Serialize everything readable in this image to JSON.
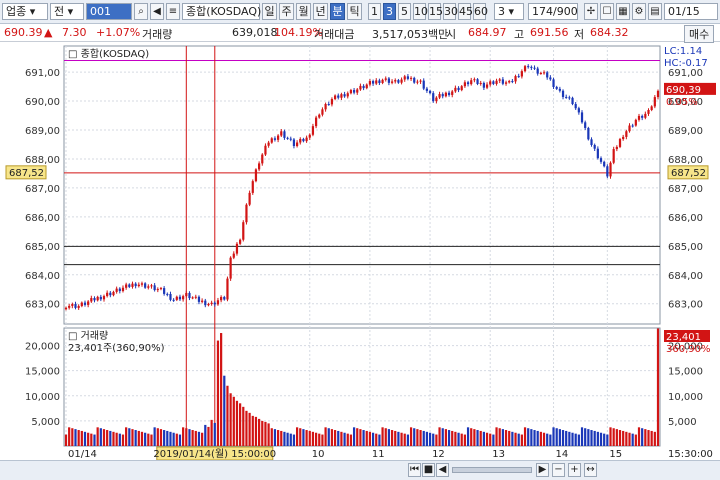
{
  "toolbar": {
    "market": "업종",
    "scope": "전",
    "code": "001",
    "name": "종합(KOSDAQ)",
    "period_tabs": [
      "일",
      "주",
      "월",
      "년",
      "분",
      "틱"
    ],
    "active_period": "분",
    "minute_tabs": [
      "1",
      "3",
      "5",
      "10",
      "15",
      "30",
      "45",
      "60"
    ],
    "active_minute": "3",
    "count_select": "3",
    "page_counter": "174/900",
    "date": "01/15"
  },
  "info": {
    "price": "690.39",
    "price_arrow": "▲",
    "change": "7.30",
    "change_pct": "+1.07%",
    "volume_label": "거래량",
    "volume": "639,018",
    "volume_pct": "104.19%",
    "amount_label": "거래대금",
    "amount": "3,517,053백만",
    "open_label": "시",
    "open": "684.97",
    "high_label": "고",
    "high": "691.56",
    "low_label": "저",
    "low": "684.32",
    "trade_button": "매수"
  },
  "colors": {
    "up": "#d21414",
    "down": "#1a37b8",
    "hline_red": "#d21414",
    "hline_magenta": "#c400c4",
    "marker_bg": "#f7e58a"
  },
  "chart_data": [
    {
      "type": "candlestick",
      "title": "종합(KOSDAQ)",
      "legend_right": [
        "LC:1.14",
        "HC:-0.17"
      ],
      "ylim": [
        682.3,
        691.9
      ],
      "yticks": [
        683,
        684,
        685,
        686,
        687,
        688,
        689,
        690,
        691
      ],
      "ytick_labels": [
        "683,00",
        "684,00",
        "685,00",
        "686,00",
        "687,00",
        "688,00",
        "689,00",
        "690,00",
        "691,00"
      ],
      "current_price_label": "690,39",
      "current_change_label": "0.05%",
      "marker_price": 687.52,
      "marker_label": "687,52",
      "hlines": [
        {
          "y": 691.4,
          "color": "magenta"
        },
        {
          "y": 687.52,
          "color": "red"
        },
        {
          "y": 684.98,
          "color": "black"
        },
        {
          "y": 684.35,
          "color": "black"
        }
      ],
      "anchors": [
        [
          0,
          682.95
        ],
        [
          4,
          682.92
        ],
        [
          10,
          683.2
        ],
        [
          16,
          683.45
        ],
        [
          22,
          683.7
        ],
        [
          26,
          683.6
        ],
        [
          30,
          683.45
        ],
        [
          34,
          683.15
        ],
        [
          38,
          683.3
        ],
        [
          42,
          683.1
        ],
        [
          46,
          682.98
        ],
        [
          48,
          683.12
        ],
        [
          50,
          683.2
        ],
        [
          52,
          684.5
        ],
        [
          55,
          685.3
        ],
        [
          58,
          686.9
        ],
        [
          61,
          687.9
        ],
        [
          64,
          688.6
        ],
        [
          68,
          688.9
        ],
        [
          72,
          688.5
        ],
        [
          76,
          688.7
        ],
        [
          80,
          689.6
        ],
        [
          84,
          690.05
        ],
        [
          88,
          690.25
        ],
        [
          92,
          690.4
        ],
        [
          96,
          690.6
        ],
        [
          100,
          690.75
        ],
        [
          104,
          690.65
        ],
        [
          108,
          690.8
        ],
        [
          112,
          690.65
        ],
        [
          116,
          690.05
        ],
        [
          120,
          690.25
        ],
        [
          124,
          690.45
        ],
        [
          128,
          690.7
        ],
        [
          132,
          690.55
        ],
        [
          136,
          690.7
        ],
        [
          140,
          690.6
        ],
        [
          144,
          691.05
        ],
        [
          146,
          691.25
        ],
        [
          148,
          691.05
        ],
        [
          152,
          690.85
        ],
        [
          156,
          690.3
        ],
        [
          160,
          689.95
        ],
        [
          163,
          689.3
        ],
        [
          166,
          688.5
        ],
        [
          169,
          687.9
        ],
        [
          171,
          687.45
        ],
        [
          173,
          688.25
        ],
        [
          176,
          688.85
        ],
        [
          180,
          689.35
        ],
        [
          184,
          689.6
        ],
        [
          187,
          690.35
        ]
      ],
      "candle_count": 188,
      "xtick_labels": [
        "01/14",
        "10",
        "11",
        "12",
        "13",
        "14",
        "15"
      ],
      "xtick_index": [
        0,
        77,
        96,
        115,
        134,
        154,
        171
      ],
      "date_marker_index": 47,
      "date_marker_label": "2019/01/14(월) 15:00:00",
      "vline_indices": [
        38,
        47
      ]
    },
    {
      "type": "bar",
      "title": "거래량",
      "subtitle": "23,401주(360,90%)",
      "ylim": [
        0,
        23500
      ],
      "yticks": [
        5000,
        10000,
        15000,
        20000
      ],
      "ytick_labels": [
        "5,000",
        "10,000",
        "15,000",
        "20,000"
      ],
      "last_value_label": "23,401",
      "last_pct_label": "360,90%",
      "time_label": "15:30:00",
      "base_volume": 3000,
      "spikes": [
        [
          44,
          4200
        ],
        [
          45,
          3800
        ],
        [
          46,
          5200
        ],
        [
          47,
          4600
        ],
        [
          48,
          21000
        ],
        [
          49,
          22500
        ],
        [
          50,
          14000
        ],
        [
          51,
          12000
        ],
        [
          52,
          10500
        ],
        [
          53,
          9800
        ],
        [
          54,
          9000
        ],
        [
          55,
          8500
        ],
        [
          56,
          7800
        ],
        [
          57,
          7000
        ],
        [
          58,
          6600
        ],
        [
          59,
          6000
        ],
        [
          60,
          5800
        ],
        [
          61,
          5400
        ],
        [
          62,
          5000
        ],
        [
          63,
          4800
        ],
        [
          64,
          4500
        ],
        [
          187,
          23401
        ]
      ]
    }
  ]
}
